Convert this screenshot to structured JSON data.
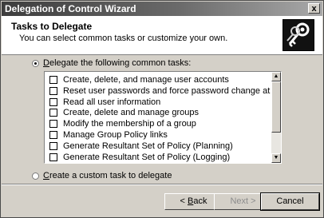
{
  "window": {
    "title": "Delegation of Control Wizard",
    "close_label": "x"
  },
  "header": {
    "title": "Tasks to Delegate",
    "subtitle": "You can select common tasks or customize your own."
  },
  "options": {
    "common": {
      "first": "D",
      "rest": "elegate the following common tasks:",
      "checked": true
    },
    "custom": {
      "first": "C",
      "rest": "reate a custom task to delegate",
      "checked": false
    }
  },
  "tasks": [
    {
      "label": "Create, delete, and manage user accounts",
      "checked": false
    },
    {
      "label": "Reset user passwords and force password change at next logon",
      "checked": false
    },
    {
      "label": "Read all user information",
      "checked": false
    },
    {
      "label": "Create, delete and manage groups",
      "checked": false
    },
    {
      "label": "Modify the membership of a group",
      "checked": false
    },
    {
      "label": "Manage Group Policy links",
      "checked": false
    },
    {
      "label": "Generate Resultant Set of Policy (Planning)",
      "checked": false
    },
    {
      "label": "Generate Resultant Set of Policy (Logging)",
      "checked": false
    }
  ],
  "buttons": {
    "back": {
      "prefix": "< ",
      "first": "B",
      "rest": "ack"
    },
    "next": {
      "label": "Next >",
      "enabled": false
    },
    "cancel": {
      "label": "Cancel"
    }
  }
}
